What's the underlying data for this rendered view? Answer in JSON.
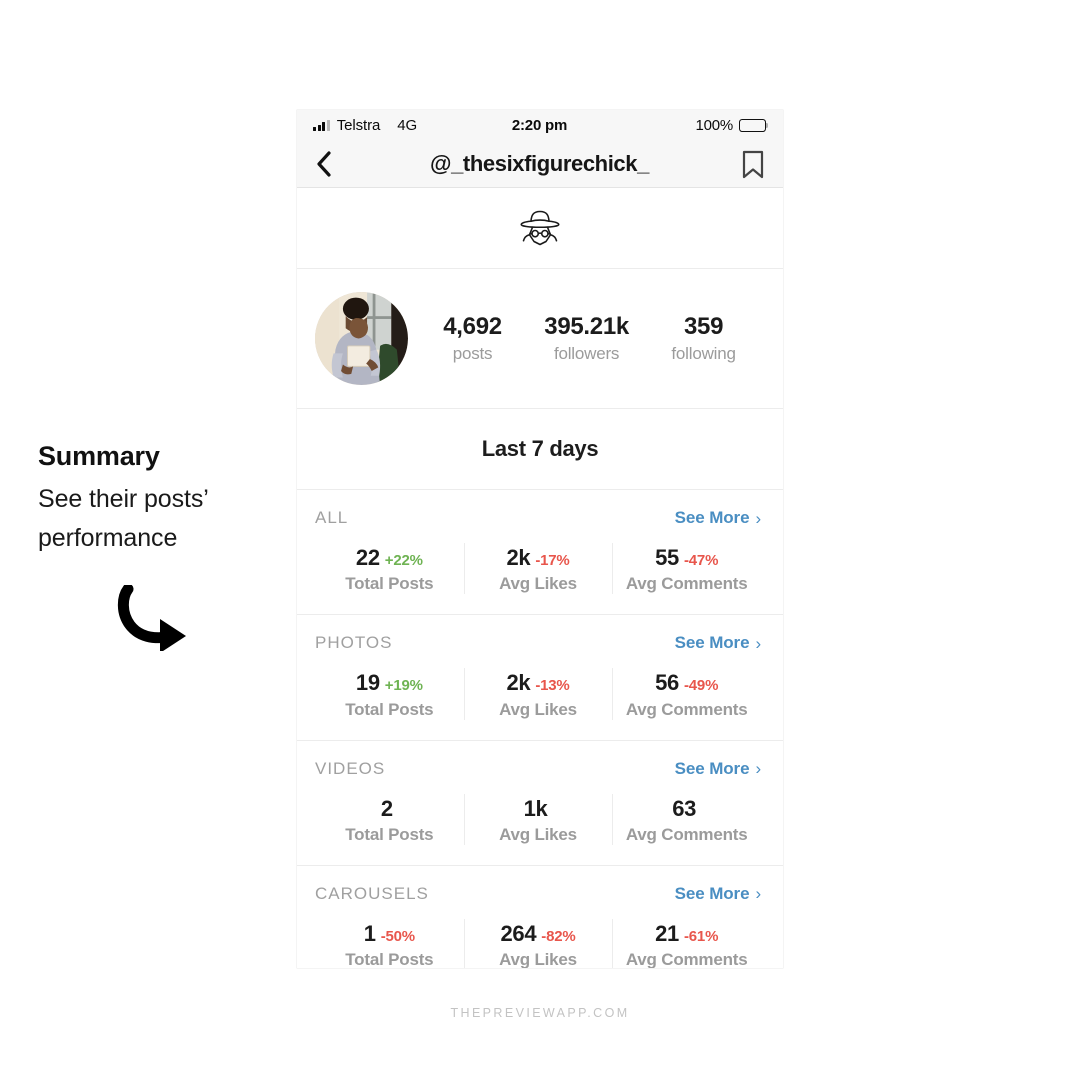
{
  "annotation": {
    "title": "Summary",
    "subtitle": "See their posts’ performance",
    "arrow_icon": "curved-arrow-down-right-icon"
  },
  "phone": {
    "status_bar": {
      "carrier": "Telstra",
      "network": "4G",
      "time": "2:20 pm",
      "battery_percent": "100%",
      "signal_icon": "signal-bars-icon",
      "battery_icon": "battery-full-icon"
    },
    "nav_bar": {
      "back_icon": "chevron-left-icon",
      "title": "@_thesixfigurechick_",
      "bookmark_icon": "bookmark-icon"
    },
    "incognito": {
      "icon": "incognito-spy-icon"
    },
    "profile": {
      "avatar_icon": "profile-avatar",
      "stats": [
        {
          "value": "4,692",
          "label": "posts"
        },
        {
          "value": "395.21k",
          "label": "followers"
        },
        {
          "value": "359",
          "label": "following"
        }
      ]
    },
    "period": {
      "label": "Last 7 days"
    },
    "see_more_label": "See More",
    "see_more_chevron": "›",
    "sections": [
      {
        "title": "ALL",
        "metrics": [
          {
            "value": "22",
            "delta": "+22%",
            "direction": "up",
            "label": "Total Posts"
          },
          {
            "value": "2k",
            "delta": "-17%",
            "direction": "down",
            "label": "Avg Likes"
          },
          {
            "value": "55",
            "delta": "-47%",
            "direction": "down",
            "label": "Avg Comments"
          }
        ]
      },
      {
        "title": "PHOTOS",
        "metrics": [
          {
            "value": "19",
            "delta": "+19%",
            "direction": "up",
            "label": "Total Posts"
          },
          {
            "value": "2k",
            "delta": "-13%",
            "direction": "down",
            "label": "Avg Likes"
          },
          {
            "value": "56",
            "delta": "-49%",
            "direction": "down",
            "label": "Avg Comments"
          }
        ]
      },
      {
        "title": "VIDEOS",
        "metrics": [
          {
            "value": "2",
            "delta": "",
            "direction": "none",
            "label": "Total Posts"
          },
          {
            "value": "1k",
            "delta": "",
            "direction": "none",
            "label": "Avg Likes"
          },
          {
            "value": "63",
            "delta": "",
            "direction": "none",
            "label": "Avg Comments"
          }
        ]
      },
      {
        "title": "CAROUSELS",
        "metrics": [
          {
            "value": "1",
            "delta": "-50%",
            "direction": "down",
            "label": "Total Posts"
          },
          {
            "value": "264",
            "delta": "-82%",
            "direction": "down",
            "label": "Avg Likes"
          },
          {
            "value": "21",
            "delta": "-61%",
            "direction": "down",
            "label": "Avg Comments"
          }
        ]
      }
    ]
  },
  "watermark": "THEPREVIEWAPP.COM",
  "colors": {
    "link": "#4a8ec2",
    "positive": "#6fb353",
    "negative": "#e8564c",
    "muted": "#9b9b9b",
    "text": "#1c1c1c"
  }
}
